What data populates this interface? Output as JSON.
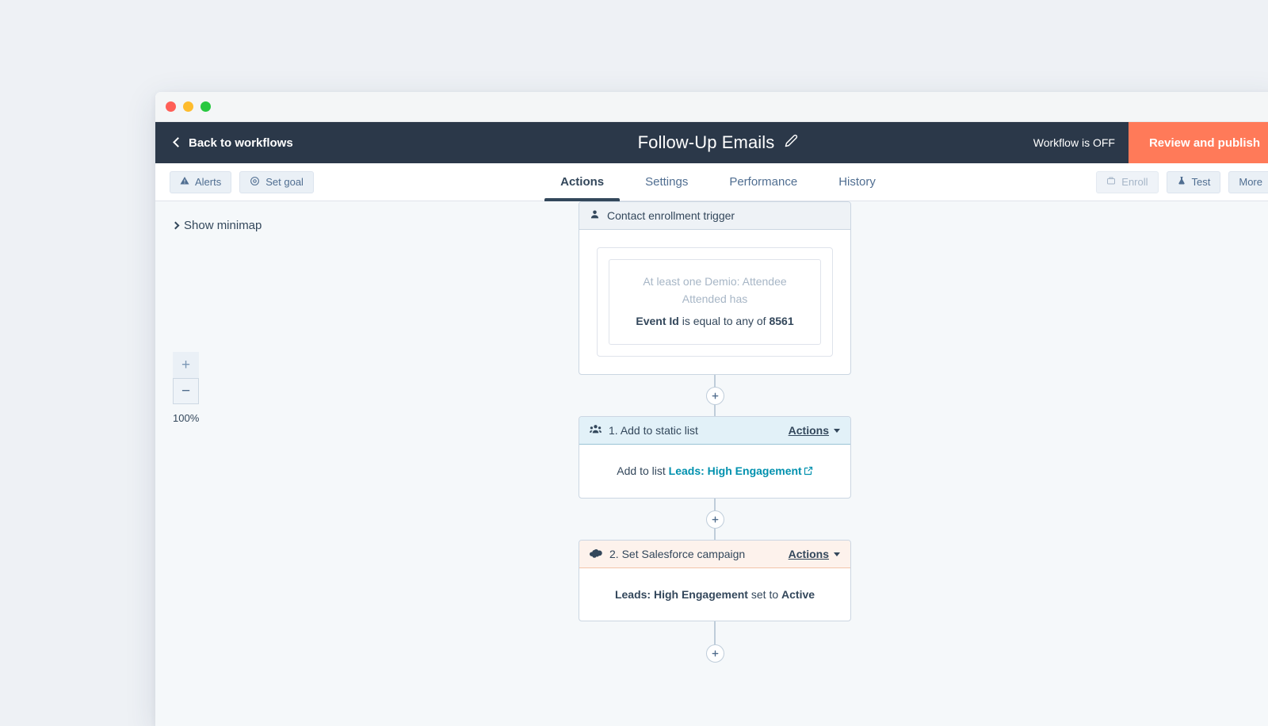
{
  "window": {
    "traffic_lights": [
      "close",
      "minimize",
      "maximize"
    ]
  },
  "appbar": {
    "back_label": "Back to workflows",
    "title": "Follow-Up Emails",
    "edit_icon": "pencil-icon",
    "workflow_status": "Workflow is OFF",
    "publish_label": "Review and publish",
    "publish_color": "#ff7a59",
    "background_color": "#2b3849"
  },
  "toolbar": {
    "left_buttons": [
      {
        "label": "Alerts",
        "icon": "warning-triangle-icon",
        "disabled": false
      },
      {
        "label": "Set goal",
        "icon": "target-icon",
        "disabled": false
      }
    ],
    "tabs": [
      {
        "label": "Actions",
        "active": true
      },
      {
        "label": "Settings",
        "active": false
      },
      {
        "label": "Performance",
        "active": false
      },
      {
        "label": "History",
        "active": false
      }
    ],
    "right_buttons": [
      {
        "label": "Enroll",
        "icon": "enroll-icon",
        "disabled": true
      },
      {
        "label": "Test",
        "icon": "flask-icon",
        "disabled": false
      },
      {
        "label": "More",
        "icon": "",
        "disabled": false
      }
    ]
  },
  "canvas": {
    "minimap_toggle_label": "Show minimap",
    "zoom_in_label": "+",
    "zoom_out_label": "−",
    "zoom_level": "100%"
  },
  "flow": {
    "trigger": {
      "header": "Contact enrollment trigger",
      "icon": "contact-person-icon",
      "filter_muted_line1": "At least one Demio: Attendee",
      "filter_muted_line2": "Attended has",
      "criteria_property": "Event Id",
      "criteria_operator": "is equal to any of",
      "criteria_value": "8561"
    },
    "steps": [
      {
        "number": "1.",
        "title": "Add to static list",
        "icon": "people-group-icon",
        "actions_label": "Actions",
        "body_prefix": "Add to list",
        "body_link": "Leads: High Engagement",
        "body_link_icon": "external-link-icon",
        "body_suffix": "",
        "header_tint": "#e2f1f8"
      },
      {
        "number": "2.",
        "title": "Set Salesforce campaign",
        "icon": "salesforce-cloud-icon",
        "actions_label": "Actions",
        "body_prefix": "Leads: High Engagement",
        "body_link": "",
        "body_mid": "set to",
        "body_suffix": "Active",
        "header_tint": "#fdf2ec"
      }
    ],
    "add_step_icon": "plus-icon"
  }
}
